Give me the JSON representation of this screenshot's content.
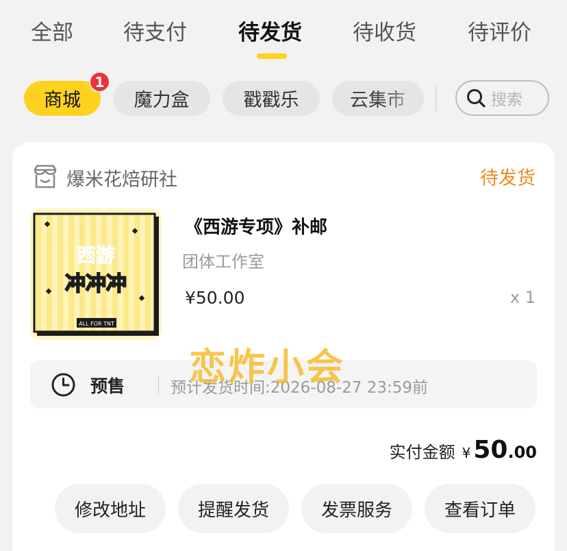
{
  "tabs": [
    "全部",
    "待支付",
    "待发货",
    "待收货",
    "待评价"
  ],
  "active_tab": "待发货",
  "filters": {
    "chips": [
      "商城",
      "魔力盒",
      "戳戳乐",
      "云集市"
    ],
    "badge": "1",
    "search_placeholder": "搜索"
  },
  "order": {
    "shop_name": "爆米花焙研社",
    "status": "待发货",
    "product": {
      "title": "《西游专项》补邮",
      "subtitle": "团体工作室",
      "price": "¥50.00",
      "quantity": "x 1",
      "image_text": [
        "西游",
        "冲冲冲",
        "ALL FOR TNT"
      ]
    },
    "presale": {
      "tag": "预售",
      "eta": "预计发货时间:2026-08-27 23:59前"
    },
    "total": {
      "label": "实付金额",
      "currency": "¥",
      "integer": "50",
      "decimal": ".00"
    },
    "actions": [
      "修改地址",
      "提醒发货",
      "发票服务",
      "查看订单"
    ]
  },
  "watermark": "恋炸小会",
  "colors": {
    "accent": "#ffd21f",
    "status": "#f08a1c",
    "badge": "#f0303a",
    "watermark": "#f7ba28"
  }
}
